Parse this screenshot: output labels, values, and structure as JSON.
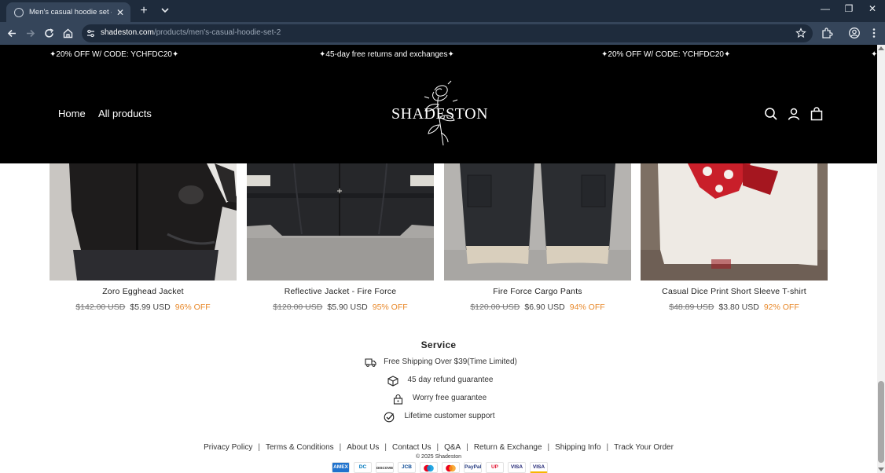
{
  "browser": {
    "tab_title": "Men's casual hoodie set – Shadeston",
    "url_host": "shadeston.com",
    "url_path": "/products/men's-casual-hoodie-set-2"
  },
  "promo": {
    "messages": [
      "✦20% OFF W/ CODE: YCHFDC20✦",
      "✦45-day free returns and exchanges✦",
      "✦20% OFF W/ CODE: YCHFDC20✦",
      "✦"
    ]
  },
  "header": {
    "nav": [
      "Home",
      "All products"
    ],
    "logo_text": "SHADESTON"
  },
  "products": [
    {
      "name": "Zoro Egghead Jacket",
      "original_price": "$142.00 USD",
      "sale_price": "$5.99 USD",
      "discount": "96% OFF",
      "image": "black fleece zip jacket"
    },
    {
      "name": "Reflective Jacket - Fire Force",
      "original_price": "$120.00 USD",
      "sale_price": "$5.90 USD",
      "discount": "95% OFF",
      "image": "black jacket with reflective stripes"
    },
    {
      "name": "Fire Force Cargo Pants",
      "original_price": "$120.00 USD",
      "sale_price": "$6.90 USD",
      "discount": "94% OFF",
      "image": "black cargo pants with cream hems"
    },
    {
      "name": "Casual Dice Print Short Sleeve T-shirt",
      "original_price": "$48.89 USD",
      "sale_price": "$3.80 USD",
      "discount": "92% OFF",
      "image": "white tee with red dice print"
    }
  ],
  "service": {
    "title": "Service",
    "items": [
      {
        "icon": "truck-icon",
        "text": "Free Shipping Over $39(Time Limited)"
      },
      {
        "icon": "box-icon",
        "text": "45 day refund guarantee"
      },
      {
        "icon": "lock-icon",
        "text": "Worry free guarantee"
      },
      {
        "icon": "check-circle-icon",
        "text": "Lifetime customer support"
      }
    ]
  },
  "footer": {
    "links": [
      "Privacy Policy",
      "Terms & Conditions",
      "About Us",
      "Contact Us",
      "Q&A",
      "Return & Exchange",
      "Shipping Info",
      "Track Your Order"
    ],
    "copyright": "© 2025 Shadeston",
    "payments": [
      {
        "name": "amex-icon",
        "label": "AMEX",
        "color": "#1f72cd"
      },
      {
        "name": "diners-icon",
        "label": "DC",
        "color": "#0079be"
      },
      {
        "name": "discover-icon",
        "label": "DISCOVER",
        "color": "#f48120"
      },
      {
        "name": "jcb-icon",
        "label": "JCB",
        "color": "#0e4c96"
      },
      {
        "name": "maestro-icon",
        "label": "",
        "color": "#eb001b"
      },
      {
        "name": "mastercard-icon",
        "label": "",
        "color": "#eb001b"
      },
      {
        "name": "paypal-icon",
        "label": "PayPal",
        "color": "#253b80"
      },
      {
        "name": "unionpay-icon",
        "label": "UP",
        "color": "#e21836"
      },
      {
        "name": "visa-icon",
        "label": "VISA",
        "color": "#1a1f71"
      },
      {
        "name": "visa-electron-icon",
        "label": "VISA",
        "color": "#1a1f71"
      }
    ]
  },
  "colors": {
    "header_bg": "#000000",
    "discount": "#e8892b",
    "browser_frame": "#35455a"
  }
}
